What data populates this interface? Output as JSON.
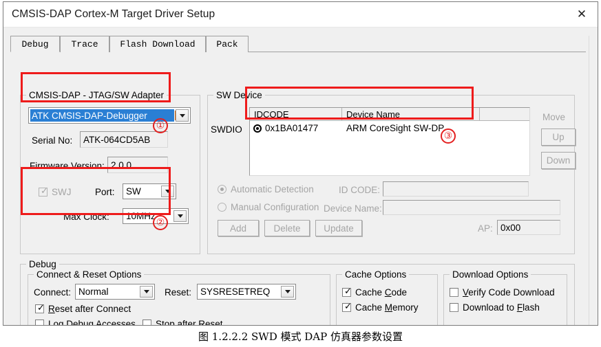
{
  "window": {
    "title": "CMSIS-DAP Cortex-M Target Driver Setup",
    "close_label": "✕"
  },
  "tabs": [
    {
      "label": "Debug",
      "active": true
    },
    {
      "label": "Trace",
      "active": false
    },
    {
      "label": "Flash Download",
      "active": false
    },
    {
      "label": "Pack",
      "active": false
    }
  ],
  "adapter_group": {
    "legend": "CMSIS-DAP - JTAG/SW Adapter",
    "adapter_combo_value": "ATK CMSIS-DAP-Debugger",
    "serial_label": "Serial No:",
    "serial_value": "ATK-064CD5AB",
    "firmware_label": "Firmware Version:",
    "firmware_value": "2.0.0",
    "swj_label": "SWJ",
    "swj_checked": true,
    "port_label": "Port:",
    "port_value": "SW",
    "max_clock_label": "Max Clock:",
    "max_clock_value": "10MHz"
  },
  "sw_device_group": {
    "legend": "SW Device",
    "swdio_label": "SWDIO",
    "columns": [
      "IDCODE",
      "Device Name"
    ],
    "rows": [
      {
        "idcode": "0x1BA01477",
        "device_name": "ARM CoreSight SW-DP"
      }
    ],
    "move_label": "Move",
    "up_label": "Up",
    "down_label": "Down",
    "automatic_detection_label": "Automatic Detection",
    "manual_configuration_label": "Manual Configuration",
    "id_code_label": "ID CODE:",
    "id_code_value": "",
    "device_name_label": "Device Name:",
    "device_name_value": "",
    "add_label": "Add",
    "delete_label": "Delete",
    "update_label": "Update",
    "ap_label": "AP:",
    "ap_value": "0x00"
  },
  "debug_group": {
    "legend": "Debug",
    "connect_reset": {
      "legend": "Connect & Reset Options",
      "connect_label": "Connect:",
      "connect_value": "Normal",
      "reset_label": "Reset:",
      "reset_value": "SYSRESETREQ",
      "reset_after_connect": {
        "label": "Reset after Connect",
        "checked": true
      },
      "log_debug_accesses": {
        "label": "Log Debug Accesses",
        "checked": false
      },
      "stop_after_reset": {
        "label": "Stop after Reset",
        "checked": false
      }
    },
    "cache_options": {
      "legend": "Cache Options",
      "cache_code": {
        "label": "Cache Code",
        "checked": true
      },
      "cache_memory": {
        "label": "Cache Memory",
        "checked": true
      }
    },
    "download_options": {
      "legend": "Download Options",
      "verify_code_download": {
        "label": "Verify Code Download",
        "checked": false
      },
      "download_to_flash": {
        "label": "Download to Flash",
        "checked": false
      }
    }
  },
  "annotations": {
    "n1": "①",
    "n2": "②",
    "n3": "③",
    "accent_color": "#ee1b1b"
  },
  "caption": "图 1.2.2.2 SWD 模式 DAP 仿真器参数设置"
}
